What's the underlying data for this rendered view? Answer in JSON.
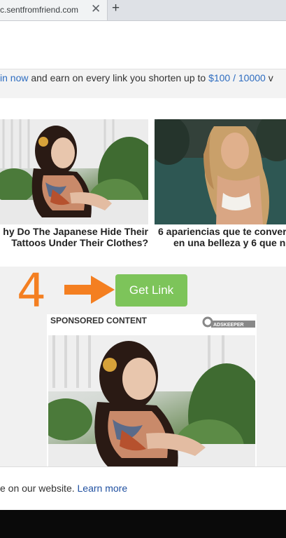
{
  "browser": {
    "tab_title": "c.sentfromfriend.com",
    "close_glyph": "✕",
    "new_tab_glyph": "+"
  },
  "info_bar": {
    "link1": "in now",
    "text_mid": " and earn on every link you shorten up to ",
    "link2": "$100 / 10000",
    "text_tail": " v"
  },
  "articles": [
    {
      "title_line1": "hy Do The Japanese Hide Their",
      "title_line2": "Tattoos Under Their Clothes?"
    },
    {
      "title_line1": "6 apariencias que te conver",
      "title_line2": "en una belleza y 6 que n"
    }
  ],
  "step": {
    "number": "4",
    "button_label": "Get Link",
    "arrow_color": "#f47f21",
    "button_color": "#7dc45a"
  },
  "sponsored": {
    "label": "SPONSORED CONTENT",
    "logo_text": "ADSKEEPER"
  },
  "cookie": {
    "text": "e on our website. ",
    "link": "Learn more"
  }
}
